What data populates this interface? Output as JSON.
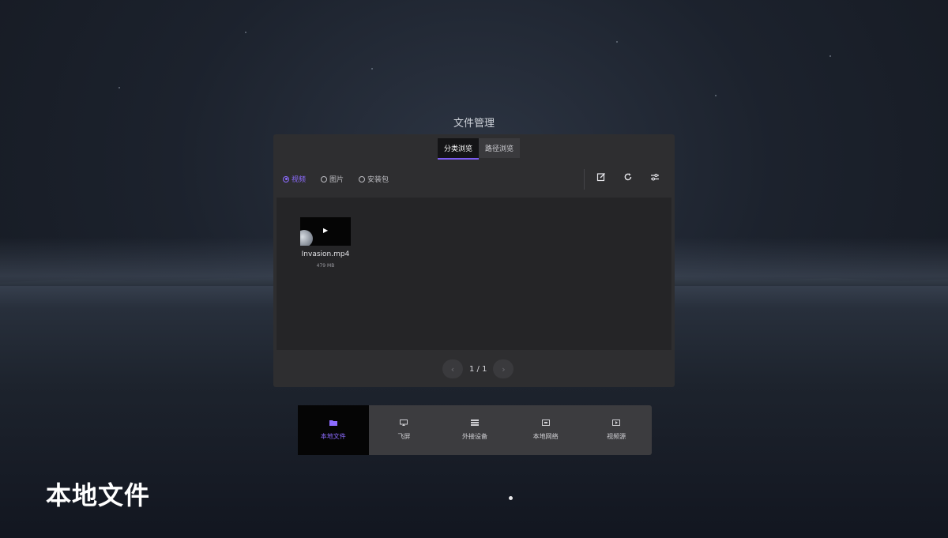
{
  "window_title": "文件管理",
  "tabs": [
    {
      "label": "分类浏览",
      "active": true
    },
    {
      "label": "路径浏览",
      "active": false
    }
  ],
  "filters": [
    {
      "label": "视频",
      "selected": true
    },
    {
      "label": "图片",
      "selected": false
    },
    {
      "label": "安装包",
      "selected": false
    }
  ],
  "toolbar_icons": [
    "edit-icon",
    "refresh-icon",
    "settings-sliders-icon"
  ],
  "files": [
    {
      "name": "Invasion.mp4",
      "size": "479 MB"
    }
  ],
  "pager": {
    "text": "1 / 1"
  },
  "dock": [
    {
      "label": "本地文件",
      "icon": "folder-icon",
      "active": true
    },
    {
      "label": "飞屏",
      "icon": "cast-screen-icon",
      "active": false
    },
    {
      "label": "外接设备",
      "icon": "external-device-icon",
      "active": false
    },
    {
      "label": "本地网络",
      "icon": "network-icon",
      "active": false
    },
    {
      "label": "视频源",
      "icon": "video-source-icon",
      "active": false
    }
  ],
  "caption": "本地文件",
  "colors": {
    "accent": "#8d6cff",
    "panel": "#2e2e30",
    "content": "#252527"
  }
}
